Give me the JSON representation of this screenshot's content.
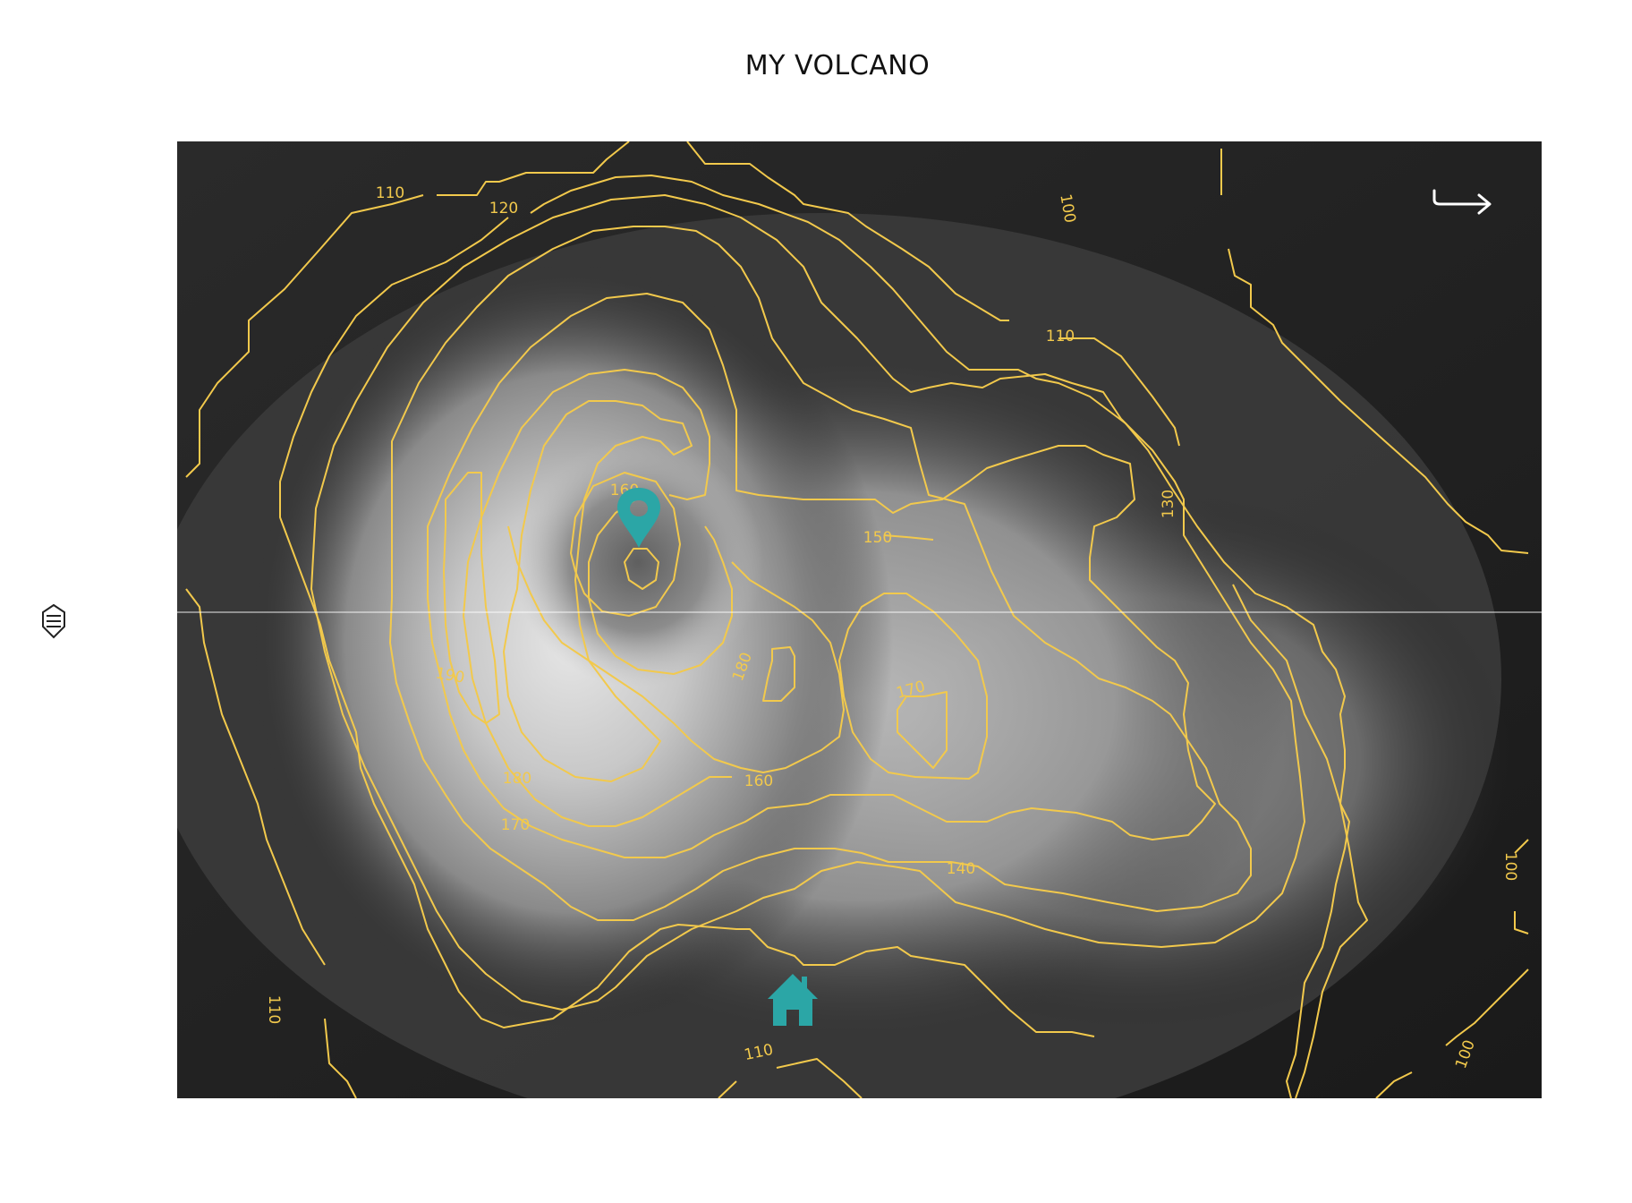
{
  "title": "MY VOLCANO",
  "chart_data": {
    "type": "heatmap",
    "title": "MY VOLCANO",
    "grid": false,
    "colorscale": "greys",
    "contour_color": "#f2c94c",
    "contour_levels": [
      100,
      110,
      120,
      130,
      140,
      150,
      160,
      170,
      180,
      190
    ],
    "contour_labels": [
      {
        "text": "110"
      },
      {
        "text": "120"
      },
      {
        "text": "100"
      },
      {
        "text": "110"
      },
      {
        "text": "130"
      },
      {
        "text": "160"
      },
      {
        "text": "150"
      },
      {
        "text": "190"
      },
      {
        "text": "180"
      },
      {
        "text": "170"
      },
      {
        "text": "180"
      },
      {
        "text": "170"
      },
      {
        "text": "160"
      },
      {
        "text": "140"
      },
      {
        "text": "100"
      },
      {
        "text": "110"
      },
      {
        "text": "110"
      },
      {
        "text": "100"
      }
    ],
    "markers": [
      {
        "name": "map-pin",
        "color": "#2ba6a6"
      },
      {
        "name": "home",
        "color": "#2ba6a6"
      }
    ],
    "annotation_arrow_color": "#ffffff",
    "crosshair_color": "#ffffff"
  },
  "controls": {
    "slider_icon": "slider-handle-icon"
  }
}
